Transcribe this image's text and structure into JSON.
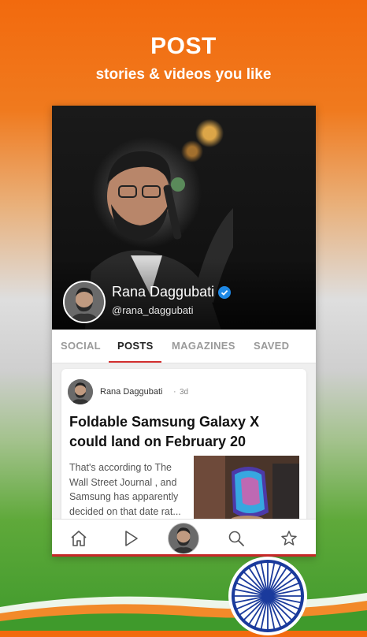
{
  "promo": {
    "title": "POST",
    "subtitle": "stories & videos you like"
  },
  "profile": {
    "name": "Rana Daggubati",
    "handle": "@rana_daggubati",
    "verified": true
  },
  "tabs": [
    {
      "label": "SOCIAL",
      "active": false
    },
    {
      "label": "POSTS",
      "active": true
    },
    {
      "label": "MAGAZINES",
      "active": false
    },
    {
      "label": "SAVED",
      "active": false
    }
  ],
  "post": {
    "author": "Rana Daggubati",
    "separator": "·",
    "time": "3d",
    "title": "Foldable Samsung Galaxy X could land on February 20",
    "excerpt": "That's according to The Wall Street Journal , and Samsung has apparently decided on that date rat..."
  },
  "bottom_nav": {
    "items": [
      "home-icon",
      "play-icon",
      "profile-avatar",
      "search-icon",
      "star-icon"
    ]
  },
  "colors": {
    "accent": "#d32f2f",
    "saffron": "#f26a0e",
    "green": "#3f9a2c",
    "chakra": "#1a3a9c"
  }
}
